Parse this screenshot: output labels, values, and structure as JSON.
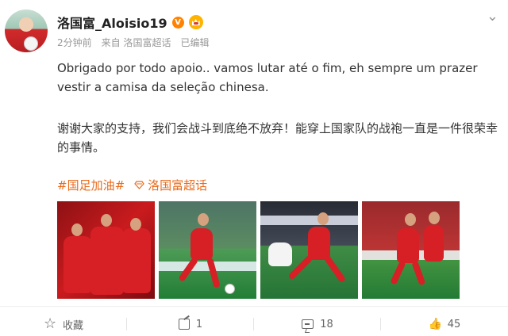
{
  "post": {
    "author": "洛国富_Aloisio19",
    "verified_badge": "V",
    "timestamp": "2分钟前",
    "source": "来自 洛国富超话",
    "edited": "已编辑",
    "menu_icon": "more-icon",
    "paragraph_1": "Obrigado por todo apoio.. vamos lutar até o fim, eh sempre um prazer vestir a camisa da seleção chinesa.",
    "paragraph_2": "谢谢大家的支持，我们会战斗到底绝不放弃！能穿上国家队的战袍一直是一件很荣幸的事情。",
    "tag_1": "#国足加油#",
    "tag_2": "洛国富超话",
    "tag_color": "#ea6b1d"
  },
  "actions": {
    "favorite_label": "收藏",
    "share_count": "1",
    "comment_count": "18",
    "like_count": "45"
  }
}
